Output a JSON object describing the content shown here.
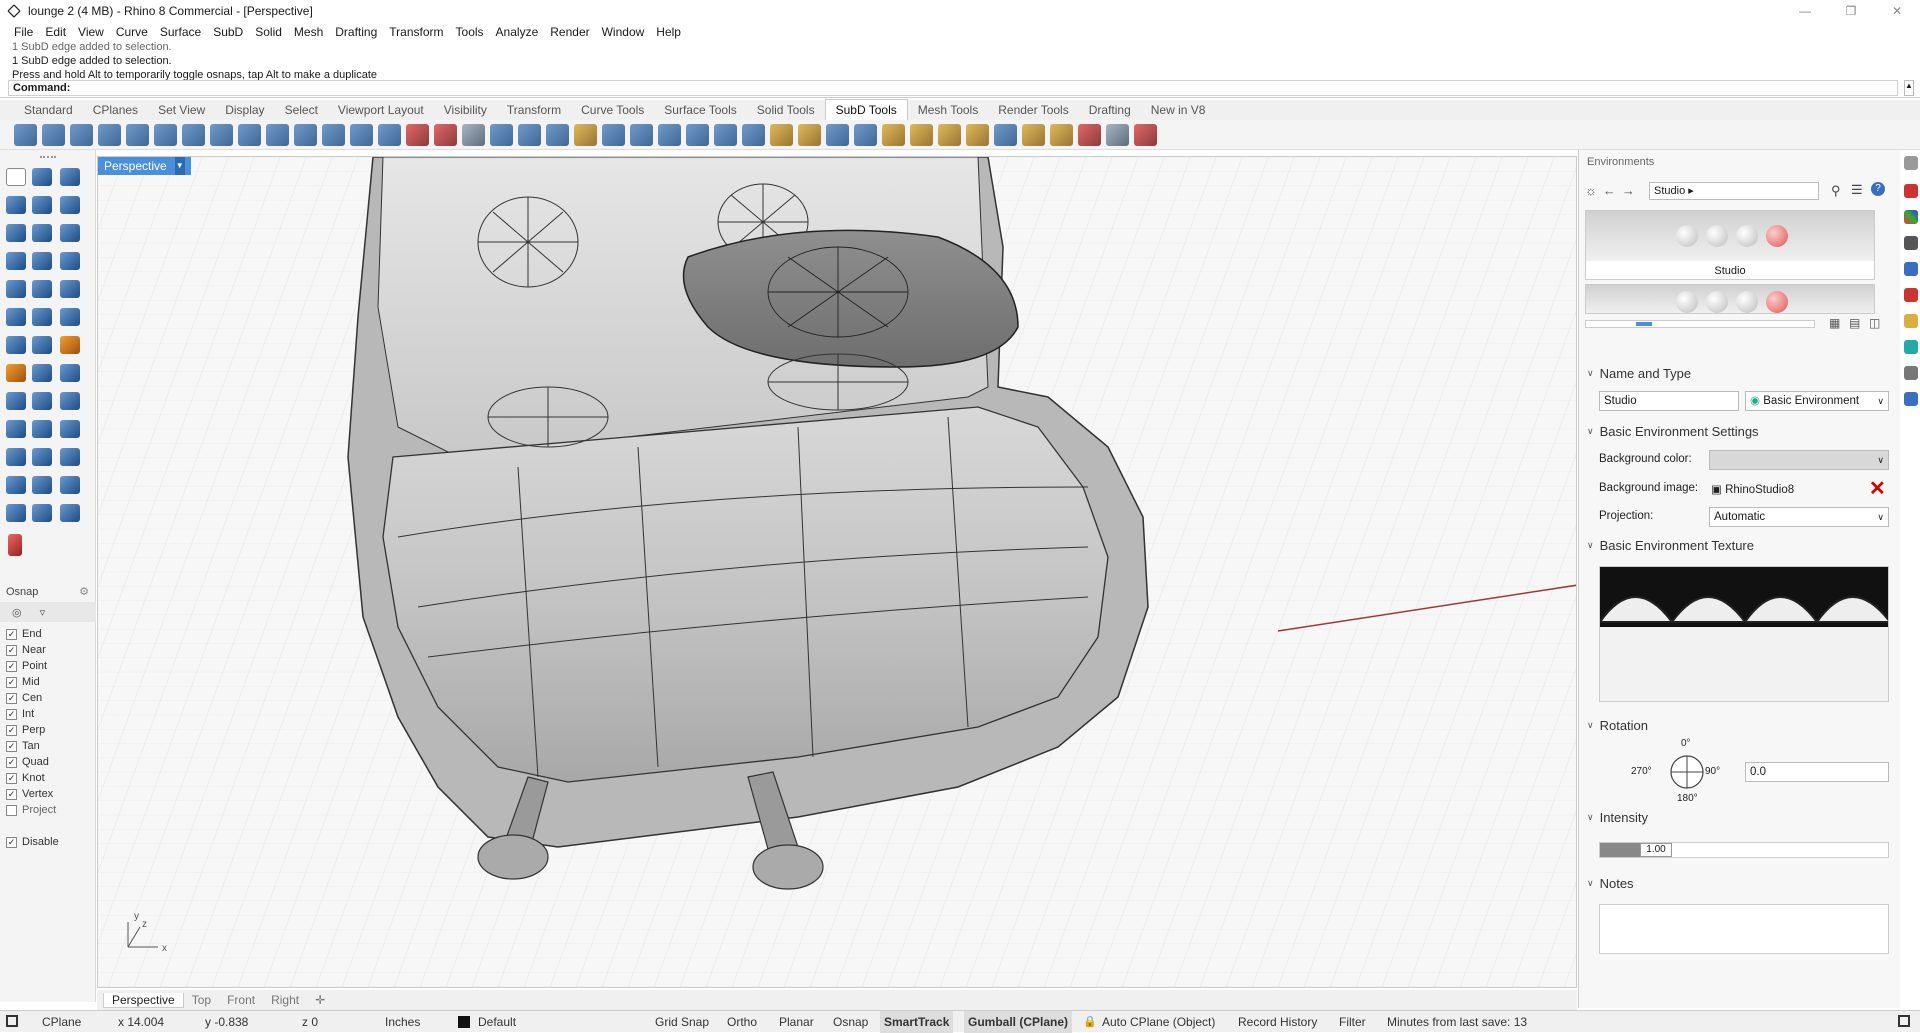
{
  "window": {
    "title": "lounge 2 (4 MB) - Rhino 8 Commercial - [Perspective]"
  },
  "menu": [
    "File",
    "Edit",
    "View",
    "Curve",
    "Surface",
    "SubD",
    "Solid",
    "Mesh",
    "Drafting",
    "Transform",
    "Tools",
    "Analyze",
    "Render",
    "Window",
    "Help"
  ],
  "command_history": [
    "1 SubD edge added to selection.",
    "1 SubD edge added to selection.",
    "Press and hold Alt to temporarily toggle osnaps, tap Alt to make a duplicate"
  ],
  "command_prompt": "Command:",
  "toolbar_tabs": [
    "Standard",
    "CPlanes",
    "Set View",
    "Display",
    "Select",
    "Viewport Layout",
    "Visibility",
    "Transform",
    "Curve Tools",
    "Surface Tools",
    "Solid Tools",
    "SubD Tools",
    "Mesh Tools",
    "Render Tools",
    "Drafting",
    "New in V8"
  ],
  "active_toolbar_tab": "SubD Tools",
  "osnap": {
    "title": "Osnap",
    "items": [
      {
        "label": "End",
        "checked": true
      },
      {
        "label": "Near",
        "checked": true
      },
      {
        "label": "Point",
        "checked": true
      },
      {
        "label": "Mid",
        "checked": true
      },
      {
        "label": "Cen",
        "checked": true
      },
      {
        "label": "Int",
        "checked": true
      },
      {
        "label": "Perp",
        "checked": true
      },
      {
        "label": "Tan",
        "checked": true
      },
      {
        "label": "Quad",
        "checked": true
      },
      {
        "label": "Knot",
        "checked": true
      },
      {
        "label": "Vertex",
        "checked": true
      },
      {
        "label": "Project",
        "checked": false
      }
    ],
    "disable": {
      "label": "Disable",
      "checked": true
    }
  },
  "viewport": {
    "label": "Perspective",
    "tabs": [
      "Perspective",
      "Top",
      "Front",
      "Right"
    ],
    "axis_x": "x",
    "axis_y": "y",
    "axis_z": "z"
  },
  "environments": {
    "panel_title": "Environments",
    "current": "Studio",
    "thumb_label": "Studio",
    "name_and_type": {
      "heading": "Name and Type",
      "name": "Studio",
      "type": "Basic Environment"
    },
    "settings": {
      "heading": "Basic Environment Settings",
      "bg_color_label": "Background color:",
      "bg_image_label": "Background image:",
      "bg_image_value": "RhinoStudio8",
      "projection_label": "Projection:",
      "projection_value": "Automatic"
    },
    "texture_heading": "Basic Environment Texture",
    "rotation": {
      "heading": "Rotation",
      "value": "0.0",
      "deg0": "0°",
      "deg90": "90°",
      "deg180": "180°",
      "deg270": "270°"
    },
    "intensity": {
      "heading": "Intensity",
      "value": "1.00",
      "fraction": 0.14
    },
    "notes_heading": "Notes"
  },
  "status": {
    "cplane": "CPlane",
    "x": "x 14.004",
    "y": "y -0.838",
    "z": "z 0",
    "units": "Inches",
    "layer": "Default",
    "grid_snap": "Grid Snap",
    "ortho": "Ortho",
    "planar": "Planar",
    "osnap": "Osnap",
    "smarttrack": "SmartTrack",
    "gumball": "Gumball (CPlane)",
    "auto_cplane": "Auto CPlane (Object)",
    "record_history": "Record History",
    "filter": "Filter",
    "save_info": "Minutes from last save: 13"
  },
  "colors": {
    "accent": "#4a90d9",
    "red_axis": "#9a3a3a",
    "green_axis": "#4a9a4a"
  }
}
